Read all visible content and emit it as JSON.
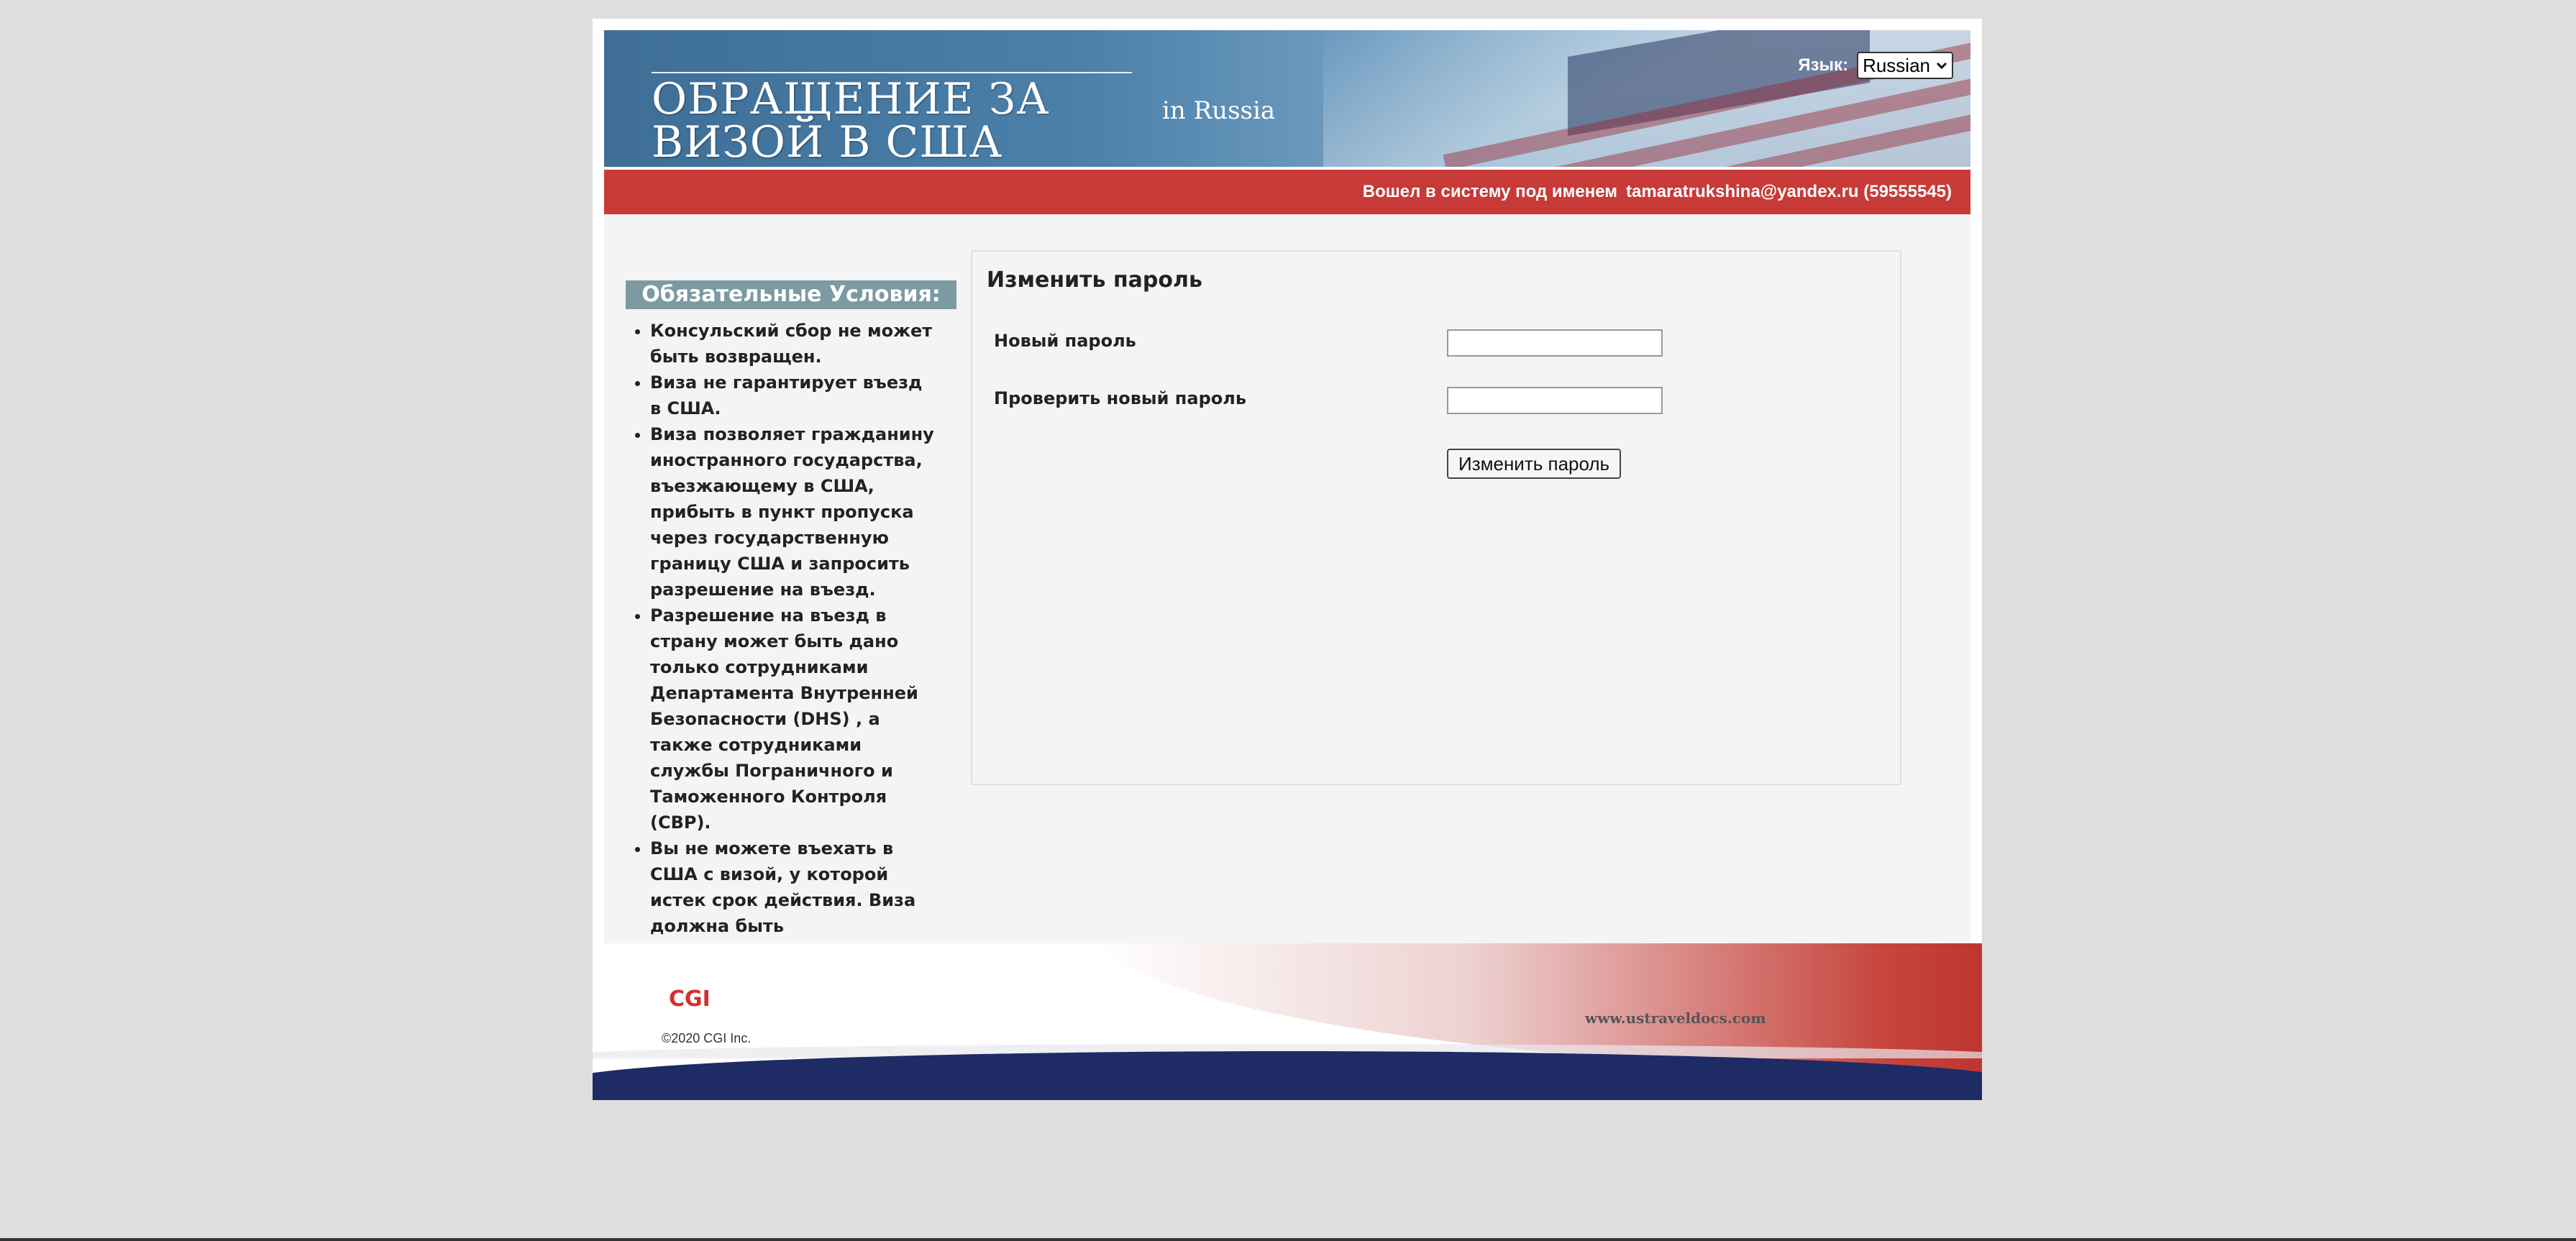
{
  "header": {
    "title_line1": "ОБРАЩЕНИЕ ЗА",
    "title_line2": "ВИЗОЙ В США",
    "country": "in  Russia",
    "language_label": "Язык:",
    "language_value": "Russian"
  },
  "status_bar": {
    "logged_in_label": "Вошел в систему под именем",
    "user": "tamaratrukshina@yandex.ru (59555545)"
  },
  "requirements": {
    "title": "Обязательные Условия:",
    "items": [
      "Консульский сбор не может быть возвращен.",
      "Виза не гарантирует въезд в США.",
      "Виза позволяет гражданину иностранного государства, въезжающему в США, прибыть в пункт пропуска через государственную границу США и запросить разрешение на въезд.",
      "Разрешение на въезд в страну может быть дано только сотрудниками Департамента Внутренней Безопасности (DHS) , а также сотрудниками службы Пограничного и Таможенного Контроля (CBP).",
      "Вы не можете въехать в США с визой, у которой истек срок действия. Виза должна быть действительна на момент въезда в США."
    ]
  },
  "form": {
    "heading": "Изменить пароль",
    "new_password_label": "Новый пароль",
    "new_password_value": "",
    "confirm_password_label": "Проверить новый пароль",
    "confirm_password_value": "",
    "submit_label": "Изменить пароль"
  },
  "footer": {
    "logo": "CGI",
    "copyright": "©2020 CGI Inc.",
    "site": "www.ustraveldocs.com"
  },
  "colors": {
    "red_bar": "#c83a37",
    "requirements_header": "#7c9aa2",
    "footer_blue": "#1e2b64",
    "cgi_red": "#d32f2f"
  }
}
